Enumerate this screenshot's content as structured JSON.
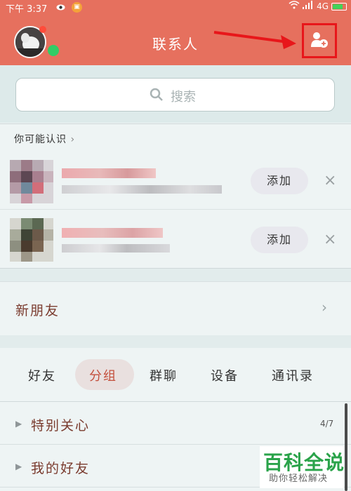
{
  "status_bar": {
    "time": "下午 3:37",
    "network": "4G",
    "eye_icon": "eye-icon",
    "app_icon": "notification-app-icon",
    "wifi_icon": "wifi-icon",
    "signal_icon": "signal-icon",
    "battery_icon": "battery-icon",
    "battery_level": 0.8
  },
  "header": {
    "title": "联系人",
    "add_contact_icon": "add-contact-icon",
    "accent_color": "#e6705e",
    "annotation_color": "#e8161a"
  },
  "search": {
    "label": "搜索",
    "icon": "search-icon"
  },
  "maybe_know": {
    "title": "你可能认识",
    "items": [
      {
        "add_label": "添加",
        "close": "×"
      },
      {
        "add_label": "添加",
        "close": "×"
      }
    ]
  },
  "new_friends": {
    "label": "新朋友",
    "chevron": "›"
  },
  "tabs": [
    {
      "label": "好友"
    },
    {
      "label": "分组",
      "active": true
    },
    {
      "label": "群聊"
    },
    {
      "label": "设备"
    },
    {
      "label": "通讯录"
    }
  ],
  "groups": [
    {
      "label": "特别关心",
      "count": "4/7"
    },
    {
      "label": "我的好友"
    }
  ],
  "watermark": {
    "title": "百科全说",
    "subtitle": "助你轻松解决"
  }
}
